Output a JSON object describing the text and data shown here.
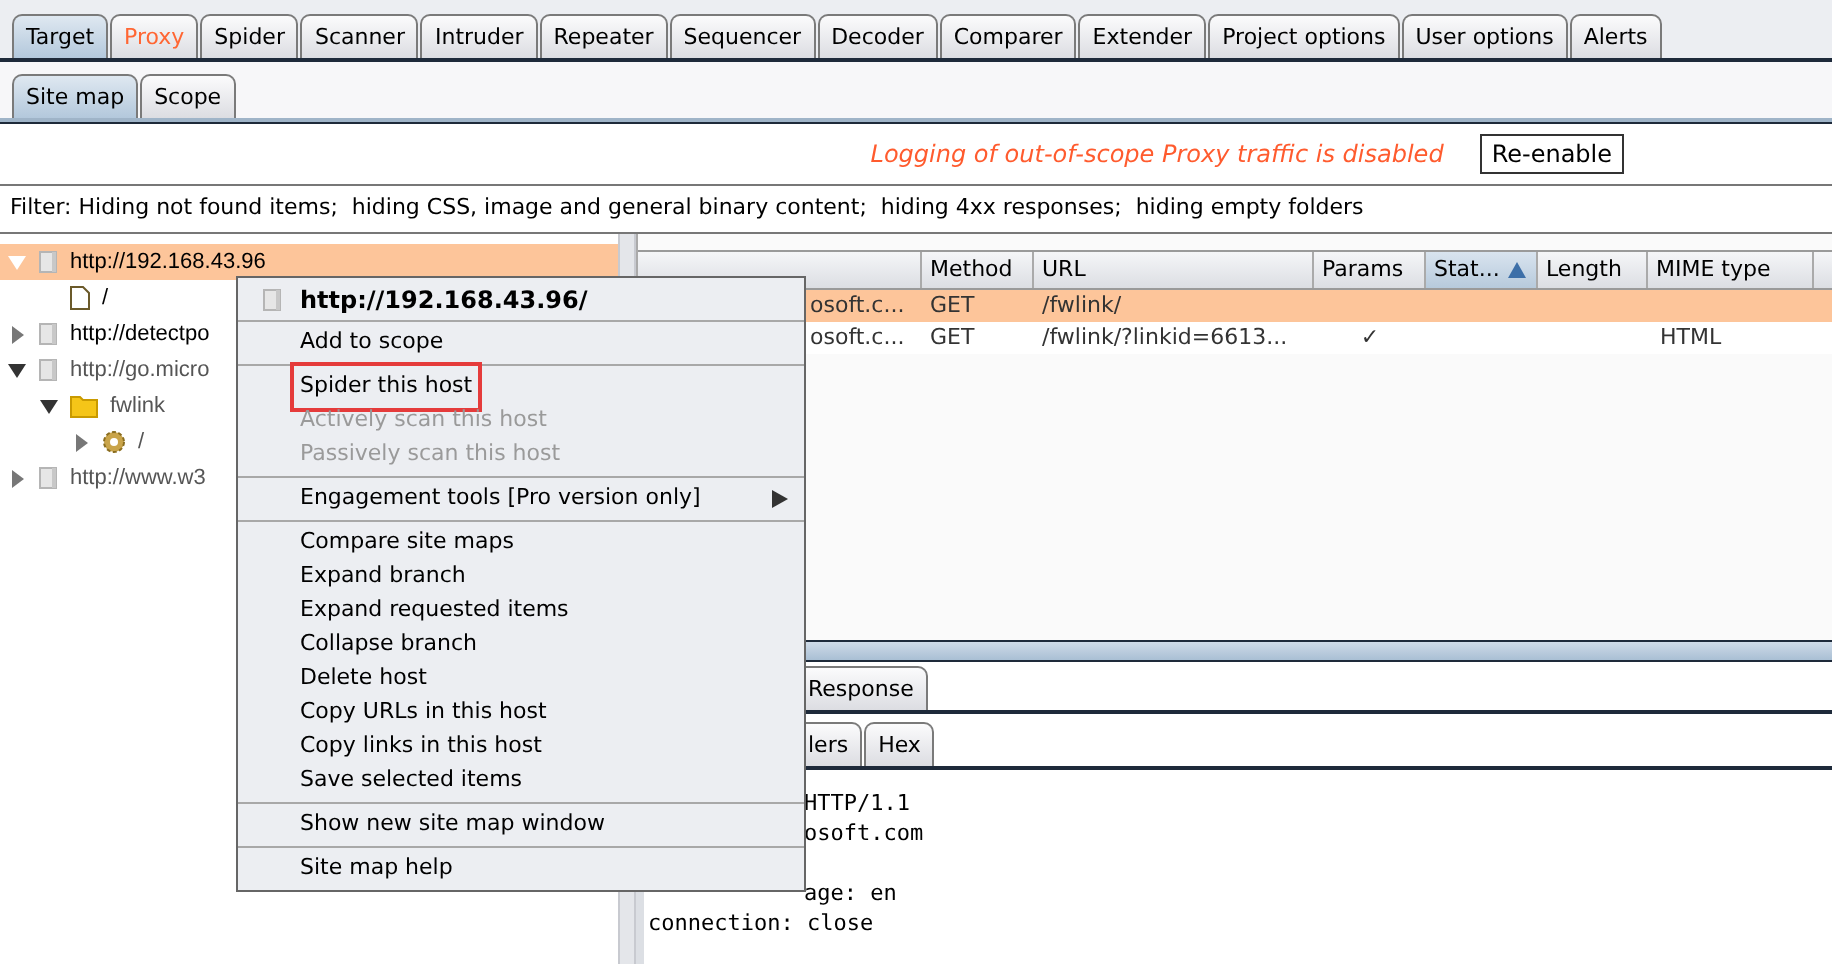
{
  "tabs": [
    {
      "label": "Target",
      "selected": true,
      "highlighted": false
    },
    {
      "label": "Proxy",
      "selected": false,
      "highlighted": true
    },
    {
      "label": "Spider",
      "selected": false,
      "highlighted": false
    },
    {
      "label": "Scanner",
      "selected": false,
      "highlighted": false
    },
    {
      "label": "Intruder",
      "selected": false,
      "highlighted": false
    },
    {
      "label": "Repeater",
      "selected": false,
      "highlighted": false
    },
    {
      "label": "Sequencer",
      "selected": false,
      "highlighted": false
    },
    {
      "label": "Decoder",
      "selected": false,
      "highlighted": false
    },
    {
      "label": "Comparer",
      "selected": false,
      "highlighted": false
    },
    {
      "label": "Extender",
      "selected": false,
      "highlighted": false
    },
    {
      "label": "Project options",
      "selected": false,
      "highlighted": false
    },
    {
      "label": "User options",
      "selected": false,
      "highlighted": false
    },
    {
      "label": "Alerts",
      "selected": false,
      "highlighted": false
    }
  ],
  "subtabs": [
    {
      "label": "Site map",
      "selected": true
    },
    {
      "label": "Scope",
      "selected": false
    }
  ],
  "notice": {
    "message": "Logging of out-of-scope Proxy traffic is disabled",
    "button": "Re-enable"
  },
  "filter": "Filter: Hiding not found items;  hiding CSS, image and general binary content;  hiding 4xx responses;  hiding empty folders",
  "tree": [
    {
      "label": "http://192.168.43.96",
      "kind": "host",
      "expanded": true,
      "selected": true,
      "dimmed": false,
      "children": [
        {
          "label": "/",
          "kind": "file",
          "selected": false,
          "dimmed": false
        }
      ]
    },
    {
      "label": "http://detectpo",
      "kind": "host",
      "expanded": false,
      "selected": false,
      "dimmed": false
    },
    {
      "label": "http://go.micro",
      "kind": "host",
      "expanded": true,
      "selected": false,
      "dimmed": true,
      "children": [
        {
          "label": "fwlink",
          "kind": "folder",
          "expanded": true,
          "selected": false,
          "dimmed": true,
          "children": [
            {
              "label": "/",
              "kind": "gear",
              "expanded": false,
              "selected": false,
              "dimmed": true
            }
          ]
        }
      ]
    },
    {
      "label": "http://www.w3",
      "kind": "host",
      "expanded": false,
      "selected": false,
      "dimmed": true
    }
  ],
  "table": {
    "columns": [
      {
        "label": "Method",
        "sorted": false
      },
      {
        "label": "URL",
        "sorted": false
      },
      {
        "label": "Params",
        "sorted": false
      },
      {
        "label": "Stat...",
        "sorted": true
      },
      {
        "label": "Length",
        "sorted": false
      },
      {
        "label": "MIME type",
        "sorted": false
      }
    ],
    "rows": [
      {
        "host": "osoft.c...",
        "method": "GET",
        "url": "/fwlink/",
        "params": "",
        "length": "",
        "mime": "",
        "selected": true
      },
      {
        "host": "osoft.c...",
        "method": "GET",
        "url": "/fwlink/?linkid=6613...",
        "params": "✓",
        "length": "",
        "mime": "HTML",
        "selected": false
      }
    ]
  },
  "message_tabs": [
    {
      "label": "Response",
      "selected": false
    }
  ],
  "view_tabs": [
    {
      "label": "lers",
      "selected": false
    },
    {
      "label": "Hex",
      "selected": false
    }
  ],
  "body_lines": [
    {
      "text": "HTTP/1.1",
      "kind": "partial"
    },
    {
      "text": "osoft.com",
      "kind": "partial"
    },
    {
      "text": "age: en",
      "kind": "partial"
    },
    {
      "text": "connection: close",
      "kind": "full"
    }
  ],
  "context_menu": [
    [
      {
        "label": "http://192.168.43.96/",
        "kind": "header",
        "disabled": false,
        "highlighted": false
      }
    ],
    [
      {
        "label": "Add to scope",
        "kind": "item",
        "disabled": false,
        "highlighted": false
      }
    ],
    [
      {
        "label": "Spider this host",
        "kind": "item",
        "disabled": false,
        "highlighted": true
      },
      {
        "label": "Actively scan this host",
        "kind": "item",
        "disabled": true,
        "highlighted": false
      },
      {
        "label": "Passively scan this host",
        "kind": "item",
        "disabled": true,
        "highlighted": false
      }
    ],
    [
      {
        "label": "Engagement tools [Pro version only]",
        "kind": "submenu",
        "disabled": false,
        "highlighted": false
      }
    ],
    [
      {
        "label": "Compare site maps",
        "kind": "item",
        "disabled": false,
        "highlighted": false
      },
      {
        "label": "Expand branch",
        "kind": "item",
        "disabled": false,
        "highlighted": false
      },
      {
        "label": "Expand requested items",
        "kind": "item",
        "disabled": false,
        "highlighted": false
      },
      {
        "label": "Collapse branch",
        "kind": "item",
        "disabled": false,
        "highlighted": false
      },
      {
        "label": "Delete host",
        "kind": "item",
        "disabled": false,
        "highlighted": false
      },
      {
        "label": "Copy URLs in this host",
        "kind": "item",
        "disabled": false,
        "highlighted": false
      },
      {
        "label": "Copy links in this host",
        "kind": "item",
        "disabled": false,
        "highlighted": false
      },
      {
        "label": "Save selected items",
        "kind": "item",
        "disabled": false,
        "highlighted": false
      }
    ],
    [
      {
        "label": "Show new site map window",
        "kind": "item",
        "disabled": false,
        "highlighted": false
      }
    ],
    [
      {
        "label": "Site map help",
        "kind": "item",
        "disabled": false,
        "highlighted": false
      }
    ]
  ]
}
